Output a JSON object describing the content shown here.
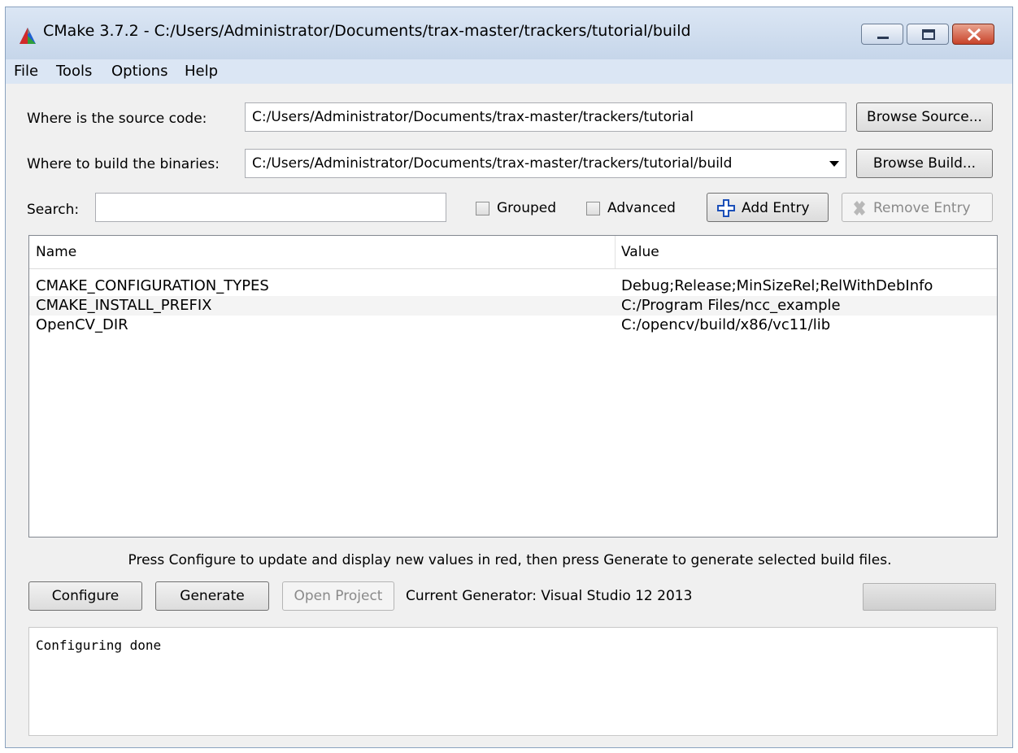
{
  "window": {
    "title": "CMake 3.7.2 - C:/Users/Administrator/Documents/trax-master/trackers/tutorial/build"
  },
  "menu": [
    "File",
    "Tools",
    "Options",
    "Help"
  ],
  "source": {
    "label": "Where is the source code:",
    "value": "C:/Users/Administrator/Documents/trax-master/trackers/tutorial",
    "browse_label": "Browse Source..."
  },
  "build": {
    "label": "Where to build the binaries:",
    "value": "C:/Users/Administrator/Documents/trax-master/trackers/tutorial/build",
    "browse_label": "Browse Build..."
  },
  "search": {
    "label": "Search:",
    "value": ""
  },
  "options": {
    "grouped_label": "Grouped",
    "grouped_checked": false,
    "advanced_label": "Advanced",
    "advanced_checked": false,
    "add_entry_label": "Add Entry",
    "remove_entry_label": "Remove Entry"
  },
  "table": {
    "columns": [
      "Name",
      "Value"
    ],
    "rows": [
      {
        "name": "CMAKE_CONFIGURATION_TYPES",
        "value": "Debug;Release;MinSizeRel;RelWithDebInfo"
      },
      {
        "name": "CMAKE_INSTALL_PREFIX",
        "value": "C:/Program Files/ncc_example"
      },
      {
        "name": "OpenCV_DIR",
        "value": "C:/opencv/build/x86/vc11/lib"
      }
    ]
  },
  "hint": "Press Configure to update and display new values in red, then press Generate to generate selected build files.",
  "actions": {
    "configure_label": "Configure",
    "generate_label": "Generate",
    "open_project_label": "Open Project",
    "generator_text": "Current Generator: Visual Studio 12 2013"
  },
  "output": {
    "text": "Configuring done"
  },
  "colors": {
    "titlebar": "#c6d6ea",
    "close_button": "#c8432a",
    "window_bg": "#f0f0f0"
  }
}
